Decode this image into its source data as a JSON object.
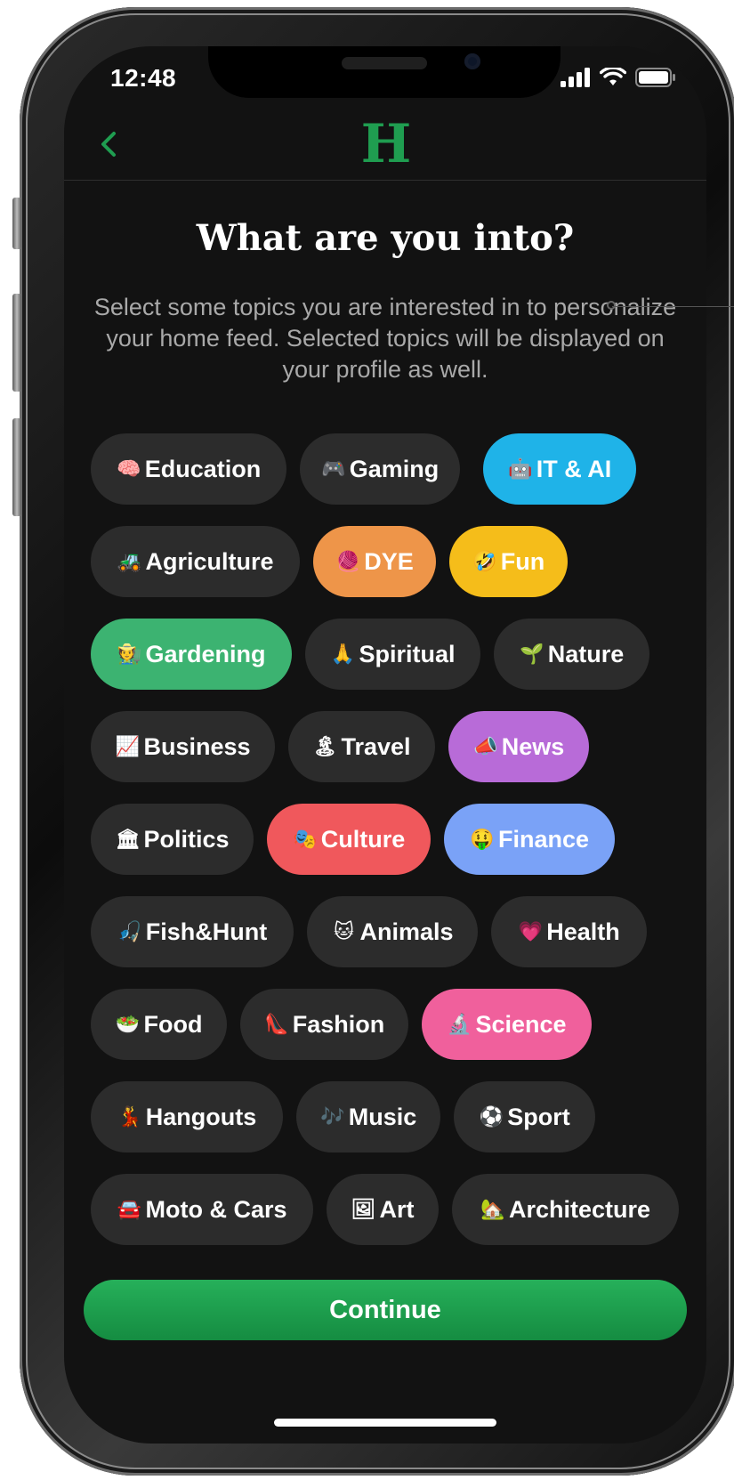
{
  "status_bar": {
    "time": "12:48"
  },
  "header": {
    "logo_text": "H",
    "back_icon": "chevron-left-icon"
  },
  "title": "What are you into?",
  "subtitle": "Select some topics you are interested in to personalize your home feed. Selected topics will be displayed on your profile as well.",
  "topics": [
    {
      "label": "Education",
      "emoji": "🧠",
      "selected": false,
      "color": "#2c2c2c"
    },
    {
      "label": "Gaming",
      "emoji": "🎮",
      "selected": false,
      "color": "#2c2c2c"
    },
    {
      "label": "IT & AI",
      "emoji": "🤖",
      "selected": true,
      "color": "#1fb3e8"
    },
    {
      "label": "Agriculture",
      "emoji": "🚜",
      "selected": false,
      "color": "#2c2c2c"
    },
    {
      "label": "DYE",
      "emoji": "🧶",
      "selected": true,
      "color": "#ee9549"
    },
    {
      "label": "Fun",
      "emoji": "🤣",
      "selected": true,
      "color": "#f5bd1a"
    },
    {
      "label": "Gardening",
      "emoji": "🧑‍🌾",
      "selected": true,
      "color": "#3cb371"
    },
    {
      "label": "Spiritual",
      "emoji": "🙏",
      "selected": false,
      "color": "#2c2c2c"
    },
    {
      "label": "Nature",
      "emoji": "🌱",
      "selected": false,
      "color": "#2c2c2c"
    },
    {
      "label": "Business",
      "emoji": "📈",
      "selected": false,
      "color": "#2c2c2c"
    },
    {
      "label": "Travel",
      "emoji": "🏝",
      "selected": false,
      "color": "#2c2c2c"
    },
    {
      "label": "News",
      "emoji": "📣",
      "selected": true,
      "color": "#b86bd8"
    },
    {
      "label": "Politics",
      "emoji": "🏛",
      "selected": false,
      "color": "#2c2c2c"
    },
    {
      "label": "Culture",
      "emoji": "🎭",
      "selected": true,
      "color": "#f0585c"
    },
    {
      "label": "Finance",
      "emoji": "🤑",
      "selected": true,
      "color": "#7aa2f7"
    },
    {
      "label": "Fish&Hunt",
      "emoji": "🎣",
      "selected": false,
      "color": "#2c2c2c"
    },
    {
      "label": "Animals",
      "emoji": "🐱",
      "selected": false,
      "color": "#2c2c2c"
    },
    {
      "label": "Health",
      "emoji": "💗",
      "selected": false,
      "color": "#2c2c2c"
    },
    {
      "label": "Food",
      "emoji": "🥗",
      "selected": false,
      "color": "#2c2c2c"
    },
    {
      "label": "Fashion",
      "emoji": "👠",
      "selected": false,
      "color": "#2c2c2c"
    },
    {
      "label": "Science",
      "emoji": "🔬",
      "selected": true,
      "color": "#f0609c"
    },
    {
      "label": "Hangouts",
      "emoji": "💃",
      "selected": false,
      "color": "#2c2c2c"
    },
    {
      "label": "Music",
      "emoji": "🎶",
      "selected": false,
      "color": "#2c2c2c"
    },
    {
      "label": "Sport",
      "emoji": "⚽",
      "selected": false,
      "color": "#2c2c2c"
    },
    {
      "label": "Moto & Cars",
      "emoji": "🚘",
      "selected": false,
      "color": "#2c2c2c"
    },
    {
      "label": "Art",
      "emoji": "🖼",
      "selected": false,
      "color": "#2c2c2c"
    },
    {
      "label": "Architecture",
      "emoji": "🏡",
      "selected": false,
      "color": "#2c2c2c"
    }
  ],
  "continue_label": "Continue"
}
